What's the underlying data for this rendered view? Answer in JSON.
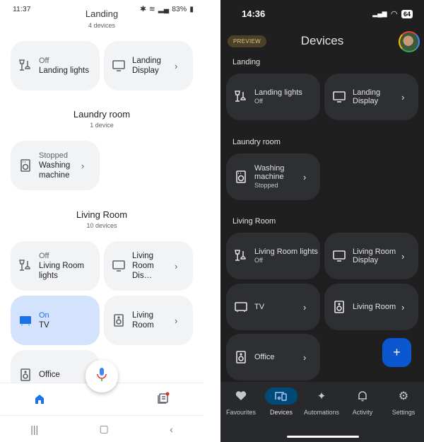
{
  "left": {
    "status": {
      "time": "11:37",
      "battery": "83%"
    },
    "rooms": [
      {
        "name": "Landing",
        "count": "4 devices"
      },
      {
        "name": "Laundry room",
        "count": "1 device"
      },
      {
        "name": "Living Room",
        "count": "10 devices"
      }
    ],
    "tiles": [
      {
        "status": "Off",
        "name": "Landing lights",
        "icon": "lamp-icon"
      },
      {
        "status": "",
        "name": "Landing Display",
        "icon": "display-icon"
      },
      {
        "status": "Stopped",
        "name": "Washing machine",
        "icon": "washer-icon"
      },
      {
        "status": "Off",
        "name": "Living Room lights",
        "icon": "lamp-icon"
      },
      {
        "status": "",
        "name": "Living Room Dis…",
        "icon": "display-icon"
      },
      {
        "status": "On",
        "name": "TV",
        "icon": "tv-icon"
      },
      {
        "status": "",
        "name": "Living Room",
        "icon": "speaker-icon"
      },
      {
        "status": "",
        "name": "Office",
        "icon": "speaker-icon"
      }
    ],
    "colors": {
      "accent": "#1a73e8",
      "tile_on": "#d3e3fd",
      "tile": "#f1f3f4"
    }
  },
  "right": {
    "status": {
      "time": "14:36",
      "battery": "64"
    },
    "preview_badge": "PREVIEW",
    "title": "Devices",
    "sections": [
      "Landing",
      "Laundry room",
      "Living Room"
    ],
    "tiles": [
      {
        "name": "Landing lights",
        "status": "Off"
      },
      {
        "name": "Landing Display",
        "status": ""
      },
      {
        "name": "Washing machine",
        "status": "Stopped"
      },
      {
        "name": "Living Room lights",
        "status": "Off"
      },
      {
        "name": "Living Room Display",
        "status": ""
      },
      {
        "name": "TV",
        "status": ""
      },
      {
        "name": "Living Room",
        "status": ""
      },
      {
        "name": "Office",
        "status": ""
      }
    ],
    "fab_label": "+",
    "nav": [
      {
        "label": "Favourites",
        "active": false
      },
      {
        "label": "Devices",
        "active": true
      },
      {
        "label": "Automations",
        "active": false
      },
      {
        "label": "Activity",
        "active": false
      },
      {
        "label": "Settings",
        "active": false
      }
    ],
    "colors": {
      "background": "#1f1f1f",
      "tile": "#2d2f33",
      "fab": "#0b57d0",
      "nav_active": "#004a77"
    }
  }
}
